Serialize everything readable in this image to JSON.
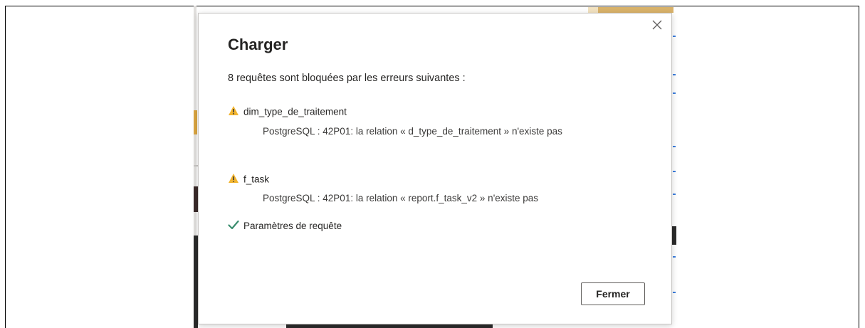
{
  "dialog": {
    "title": "Charger",
    "summary": "8 requêtes sont bloquées par les erreurs suivantes :",
    "items": [
      {
        "icon": "warning-icon",
        "name": "dim_type_de_traitement",
        "detail": "PostgreSQL : 42P01: la relation « d_type_de_traitement » n'existe pas"
      },
      {
        "icon": "warning-icon",
        "name": "f_task",
        "detail": "PostgreSQL : 42P01: la relation « report.f_task_v2 » n'existe pas"
      },
      {
        "icon": "checkmark-icon",
        "name": "Paramètres de requête"
      }
    ],
    "close_button_label": "Fermer"
  },
  "colors": {
    "warning": "#f2b530",
    "success": "#3a8d6e",
    "text": "#252423"
  }
}
